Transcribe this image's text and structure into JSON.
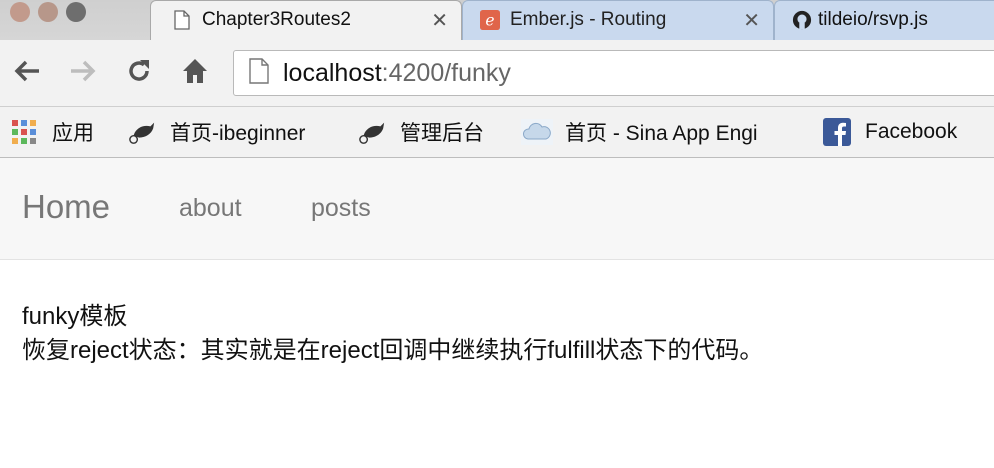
{
  "window": {
    "traffic_lights": [
      "close",
      "minimize",
      "zoom"
    ]
  },
  "tabs": [
    {
      "title": "Chapter3Routes2",
      "icon": "page-icon",
      "close": "✕",
      "active": true
    },
    {
      "title": "Ember.js - Routing",
      "icon": "ember-icon",
      "close": "✕",
      "active": false
    },
    {
      "title": "tildeio/rsvp.js",
      "icon": "github-icon",
      "active": false
    }
  ],
  "toolbar": {
    "url_host": "localhost",
    "url_path": ":4200/funky"
  },
  "bookmarks": [
    {
      "label": "应用",
      "icon": "apps-grid-icon"
    },
    {
      "label": "首页-ibeginner",
      "icon": "bird-icon"
    },
    {
      "label": "管理后台",
      "icon": "bird-icon"
    },
    {
      "label": "首页 - Sina App Engi",
      "icon": "cloud-icon"
    },
    {
      "label": "Facebook",
      "icon": "facebook-icon"
    }
  ],
  "app_nav": {
    "brand": "Home",
    "links": [
      "about",
      "posts"
    ]
  },
  "content": {
    "heading": "funky模板",
    "body": "恢复reject状态：其实就是在reject回调中继续执行fulfill状态下的代码。"
  },
  "colors": {
    "close_light": "#c29a8c",
    "minimize_light": "#b7978a",
    "zoom_light": "#6e6e6e",
    "inactive_tab": "#c9d9ee",
    "facebook": "#3b5998"
  }
}
